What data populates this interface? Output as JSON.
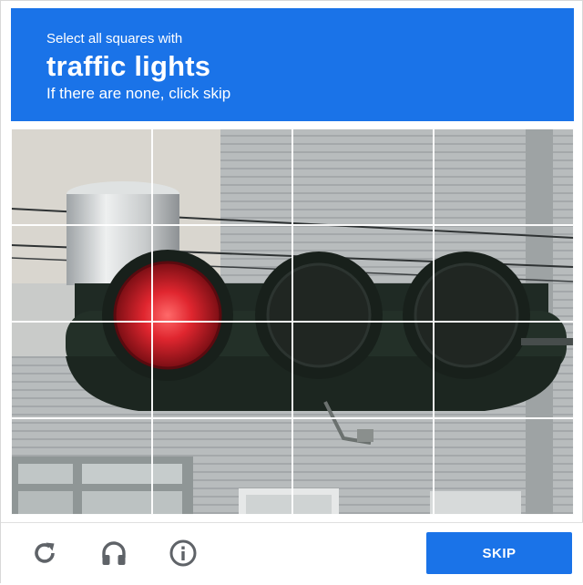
{
  "header": {
    "instruction": "Select all squares with",
    "target": "traffic lights",
    "hint": "If there are none, click skip"
  },
  "grid": {
    "rows": 4,
    "cols": 4
  },
  "footer": {
    "reload_icon": "reload-icon",
    "audio_icon": "headphones-icon",
    "info_icon": "info-icon",
    "skip_label": "SKIP"
  },
  "colors": {
    "accent": "#1a73e8",
    "signal_red": "#e0262f"
  }
}
